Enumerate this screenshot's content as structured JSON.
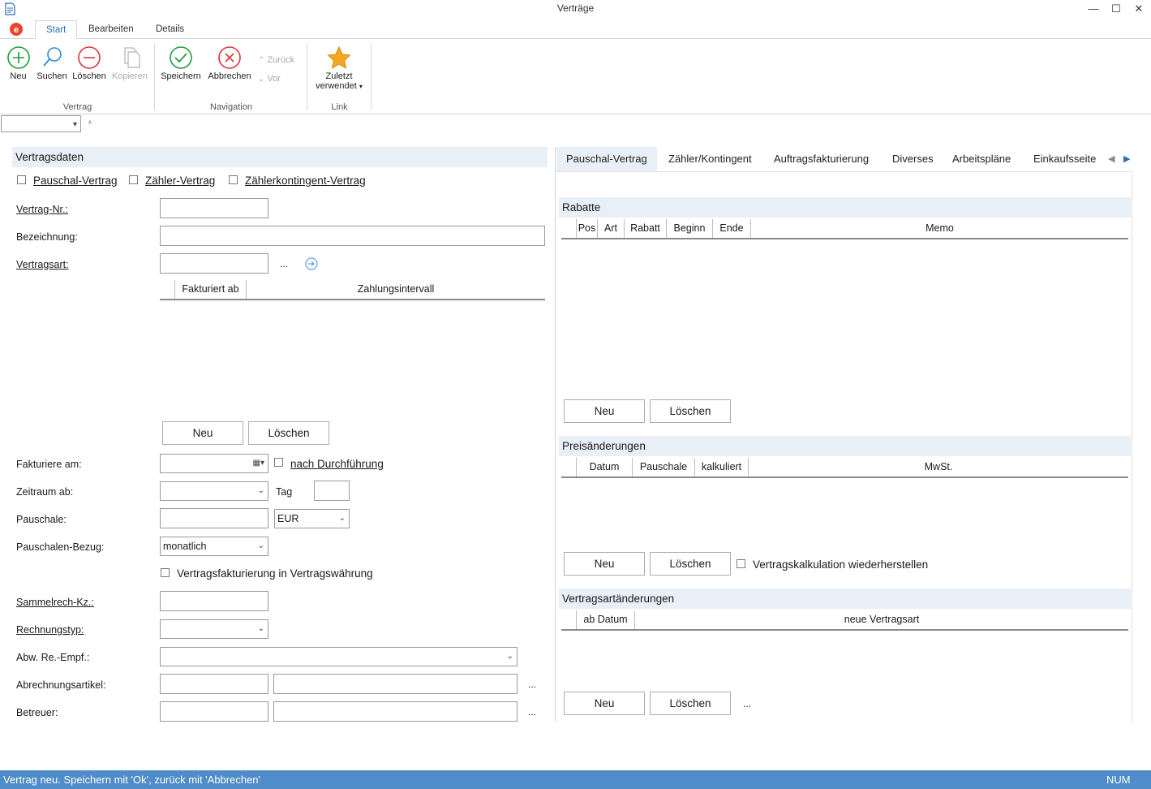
{
  "window": {
    "title": "Verträge",
    "minimize": "—",
    "maximize": "☐",
    "close": "✕"
  },
  "ribbon": {
    "tabs": [
      "Start",
      "Bearbeiten",
      "Details"
    ],
    "buttons": {
      "neu": "Neu",
      "suchen": "Suchen",
      "loeschen": "Löschen",
      "kopieren": "Kopieren",
      "speichern": "Speichern",
      "abbrechen": "Abbrechen",
      "zurueck": "Zurück",
      "vor": "Vor",
      "zuletzt1": "Zuletzt",
      "zuletzt2": "verwendet"
    },
    "groups": {
      "vertrag": "Vertrag",
      "navigation": "Navigation",
      "link": "Link"
    }
  },
  "left": {
    "section_title": "Vertragsdaten",
    "checkboxes": [
      "Pauschal-Vertrag",
      "Zähler-Vertrag",
      "Zählerkontingent-Vertrag"
    ],
    "labels": {
      "vertrag_nr": "Vertrag-Nr.:",
      "bezeichnung": "Bezeichnung:",
      "vertragsart": "Vertragsart:",
      "fakturiere_am": "Fakturiere am:",
      "zeitraum_ab": "Zeitraum ab:",
      "tag": "Tag",
      "pauschale": "Pauschale:",
      "pauschalen_bezug": "Pauschalen-Bezug:",
      "sammelrech": "Sammelrech-Kz.:",
      "rechnungstyp": "Rechnungstyp:",
      "abw": "Abw. Re.-Empf.:",
      "abrechnungsartikel": "Abrechnungsartikel:",
      "betreuer": "Betreuer:"
    },
    "ellipsis": "...",
    "grid_cols": [
      "Fakturiert ab",
      "Zahlungsintervall"
    ],
    "btn_neu": "Neu",
    "btn_loeschen": "Löschen",
    "nach_durchfuehrung": "nach Durchführung",
    "currency": "EUR",
    "pauschalen_bezug_value": "monatlich",
    "vertragsfakturierung": "Vertragsfakturierung in Vertragswährung"
  },
  "right": {
    "tabs": [
      "Pauschal-Vertrag",
      "Zähler/Kontingent",
      "Auftragsfakturierung",
      "Diverses",
      "Arbeitspläne",
      "Einkaufsseite"
    ],
    "rabatte": {
      "title": "Rabatte",
      "cols": [
        "Pos",
        "Art",
        "Rabatt",
        "Beginn",
        "Ende",
        "Memo"
      ]
    },
    "preis": {
      "title": "Preisänderungen",
      "cols": [
        "Datum",
        "Pauschale",
        "kalkuliert",
        "MwSt."
      ],
      "checkbox": "Vertragskalkulation wiederherstellen"
    },
    "vart": {
      "title": "Vertragsartänderungen",
      "cols": [
        "ab Datum",
        "neue Vertragsart"
      ]
    },
    "btn_neu": "Neu",
    "btn_loeschen": "Löschen",
    "ellipsis": "..."
  },
  "status": {
    "message": "Vertrag neu. Speichern mit 'Ok', zurück mit 'Abbrechen'",
    "num": "NUM"
  },
  "colors": {
    "accent": "#4f8cc9",
    "section": "#e8eff7"
  }
}
